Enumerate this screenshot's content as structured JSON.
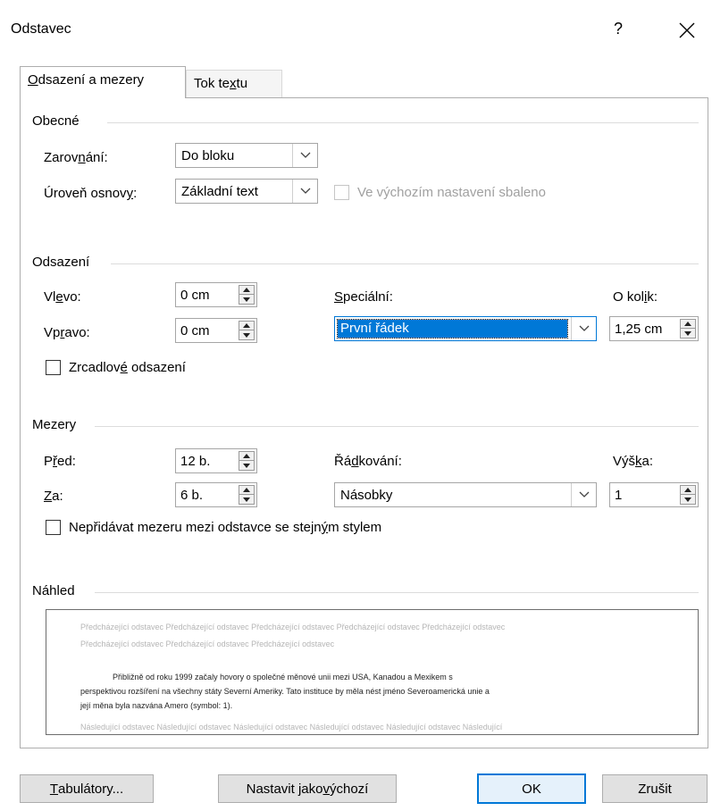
{
  "window": {
    "title": "Odstavec",
    "help_label": "?"
  },
  "tabs": [
    {
      "pre": "",
      "ul": "O",
      "post": "dsazení a mezery"
    },
    {
      "pre": "Tok te",
      "ul": "x",
      "post": "tu"
    }
  ],
  "general": {
    "heading": "Obecné",
    "alignment": {
      "pre": "Zarov",
      "ul": "n",
      "post": "ání:",
      "value": "Do bloku"
    },
    "outline_level": {
      "pre": "Úroveň osnov",
      "ul": "y",
      "post": ":",
      "value": "Základní text"
    },
    "collapsed_label": "Ve výchozím nastavení sbaleno"
  },
  "indentation": {
    "heading": "Odsazení",
    "left": {
      "pre": "Vl",
      "ul": "e",
      "post": "vo:",
      "value": "0 cm"
    },
    "right": {
      "pre": "Vp",
      "ul": "r",
      "post": "avo:",
      "value": "0 cm"
    },
    "special": {
      "pre": "",
      "ul": "S",
      "post": "peciální:",
      "value": "První řádek"
    },
    "by": {
      "pre": "O kol",
      "ul": "i",
      "post": "k:",
      "value": "1,25 cm"
    },
    "mirror": {
      "pre": "Zrcadlov",
      "ul": "é",
      "post": " odsazení"
    }
  },
  "spacing": {
    "heading": "Mezery",
    "before": {
      "pre": "P",
      "ul": "ř",
      "post": "ed:",
      "value": "12 b."
    },
    "after": {
      "pre": "",
      "ul": "Z",
      "post": "a:",
      "value": "6 b."
    },
    "line_spacing": {
      "pre": "Řá",
      "ul": "d",
      "post": "kování:",
      "value": "Násobky"
    },
    "at": {
      "pre": "Výš",
      "ul": "k",
      "post": "a:",
      "value": "1"
    },
    "dont_add": {
      "pre": "Nepřidávat mezeru mezi odstavce se stejn",
      "ul": "ý",
      "post": "m stylem"
    }
  },
  "preview": {
    "heading": "Náhled",
    "prev_line1": "Předcházející odstavec Předcházející odstavec Předcházející odstavec Předcházející odstavec Předcházející odstavec",
    "prev_line2": "Předcházející odstavec Předcházející odstavec Předcházející odstavec",
    "main_line1": "Přibližně od roku 1999 začaly hovory o společné měnové unii mezi USA, Kanadou a Mexikem s",
    "main_line2": "perspektivou rozšíření na všechny státy Severní Ameriky. Tato instituce by měla nést jméno Severoamerická unie a",
    "main_line3": "její měna byla nazvána Amero (symbol: 1).",
    "next_line1": "Následující odstavec Následující odstavec Následující odstavec Následující odstavec Následující odstavec Následující"
  },
  "buttons": {
    "tabs": {
      "pre": "",
      "ul": "T",
      "post": "abulátory..."
    },
    "set_default": {
      "pre": "Nastavit jako ",
      "ul": "v",
      "post": "ýchozí"
    },
    "ok": "OK",
    "cancel": "Zrušit"
  }
}
